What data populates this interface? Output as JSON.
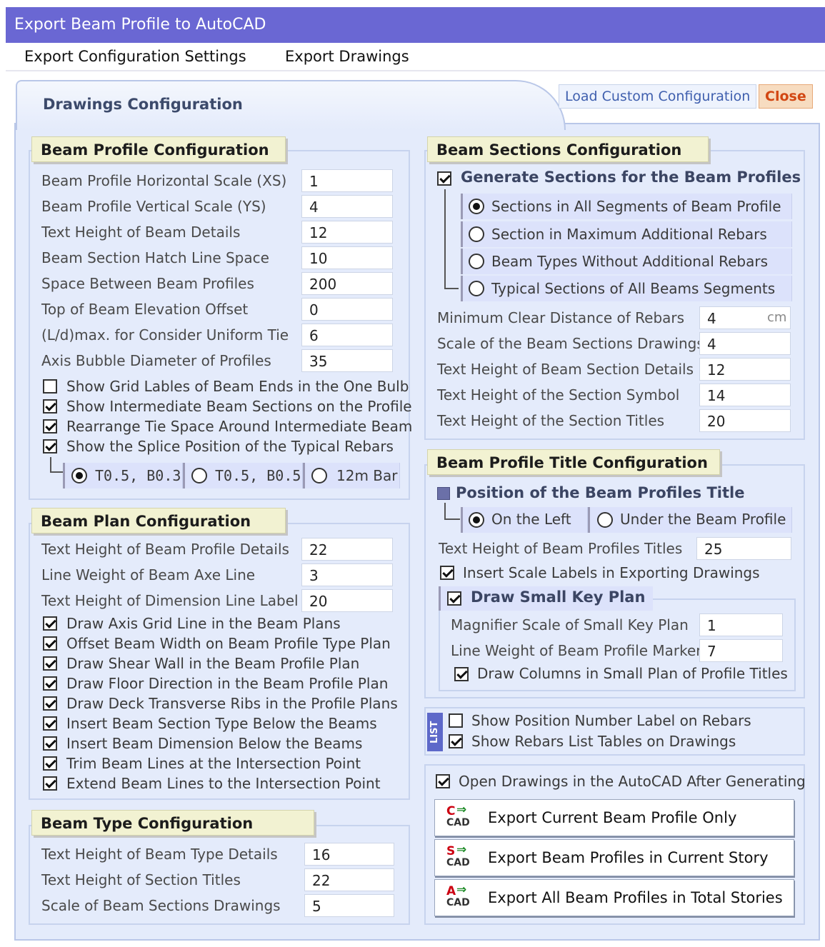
{
  "window": {
    "title": "Export Beam Profile to AutoCAD"
  },
  "menu": [
    "Export Configuration Settings",
    "Export Drawings"
  ],
  "tab": {
    "label": "Drawings Configuration"
  },
  "toolbar": {
    "load_label": "Load Custom Configuration",
    "close_label": "Close"
  },
  "beam_profile": {
    "title": "Beam Profile Configuration",
    "fields": [
      {
        "label": "Beam Profile Horizontal Scale  (XS)",
        "value": "1"
      },
      {
        "label": "Beam Profile Vertical  Scale      (YS)",
        "value": "4"
      },
      {
        "label": "Text Height of Beam Details",
        "value": "12"
      },
      {
        "label": "Beam Section Hatch Line Space",
        "value": "10"
      },
      {
        "label": "Space Between Beam Profiles",
        "value": "200"
      },
      {
        "label": "Top of  Beam Elevation Offset",
        "value": "0"
      },
      {
        "label": "(L/d)max. for Consider Uniform Tie",
        "value": "6"
      },
      {
        "label": "Axis Bubble Diameter of  Profiles",
        "value": "35"
      }
    ],
    "checks": [
      {
        "label": "Show Grid Lables of Beam Ends in the One Bulb",
        "checked": false
      },
      {
        "label": "Show Intermediate Beam Sections on the Profile",
        "checked": true
      },
      {
        "label": "Rearrange Tie Space Around Intermediate Beam",
        "checked": true
      },
      {
        "label": "Show the Splice Position of the Typical Rebars",
        "checked": true
      }
    ],
    "splice_options": [
      {
        "label": "T0.5, B0.3",
        "selected": true
      },
      {
        "label": "T0.5, B0.5",
        "selected": false
      },
      {
        "label": "12m Bar",
        "selected": false
      }
    ]
  },
  "beam_plan": {
    "title": "Beam Plan Configuration",
    "fields": [
      {
        "label": "Text Height of Beam Profile Details",
        "value": "22"
      },
      {
        "label": "Line Weight of Beam Axe Line",
        "value": "3"
      },
      {
        "label": "Text Height of Dimension Line Label",
        "value": "20"
      }
    ],
    "checks": [
      {
        "label": "Draw Axis Grid Line in the Beam Plans",
        "checked": true
      },
      {
        "label": "Offset Beam Width on Beam Profile Type Plan",
        "checked": true
      },
      {
        "label": "Draw Shear Wall in the Beam Profile Plan",
        "checked": true
      },
      {
        "label": "Draw Floor Direction in the Beam Profile Plan",
        "checked": true
      },
      {
        "label": "Draw Deck Transverse Ribs in the Profile Plans",
        "checked": true
      },
      {
        "label": "Insert Beam Section Type Below the Beams",
        "checked": true
      },
      {
        "label": "Insert Beam Dimension Below the Beams",
        "checked": true
      },
      {
        "label": "Trim Beam Lines at the Intersection Point",
        "checked": true
      },
      {
        "label": "Extend Beam Lines to the Intersection Point",
        "checked": true
      }
    ]
  },
  "beam_type": {
    "title": "Beam Type Configuration",
    "fields": [
      {
        "label": "Text Height of Beam Type Details",
        "value": "16"
      },
      {
        "label": "Text  Height of Section Titles",
        "value": "22"
      },
      {
        "label": "Scale of Beam Sections Drawings",
        "value": "5"
      }
    ]
  },
  "beam_sections": {
    "title": "Beam Sections Configuration",
    "generate": {
      "label": "Generate Sections for the Beam Profiles",
      "checked": true
    },
    "options": [
      {
        "label": "Sections in All Segments of Beam Profile",
        "selected": true
      },
      {
        "label": "Section in Maximum Additional Rebars",
        "selected": false
      },
      {
        "label": "Beam Types Without Additional Rebars",
        "selected": false
      },
      {
        "label": "Typical Sections of All Beams Segments",
        "selected": false
      }
    ],
    "fields": [
      {
        "label": "Minimum Clear Distance of Rebars",
        "value": "4",
        "unit": "cm"
      },
      {
        "label": "Scale of the Beam Sections Drawings",
        "value": "4"
      },
      {
        "label": "Text Height of Beam Section Details",
        "value": "12"
      },
      {
        "label": "Text Height of the Section Symbol",
        "value": "14"
      },
      {
        "label": "Text Height of the Section Titles",
        "value": "20"
      }
    ]
  },
  "profile_title": {
    "title": "Beam Profile Title Configuration",
    "position_label": "Position of the Beam Profiles Title",
    "position_options": [
      {
        "label": "On the Left",
        "selected": true
      },
      {
        "label": "Under the Beam Profile",
        "selected": false
      }
    ],
    "text_height": {
      "label": "Text Height of Beam Profiles Titles",
      "value": "25"
    },
    "insert_scale": {
      "label": "Insert Scale Labels in Exporting Drawings",
      "checked": true
    },
    "key_plan": {
      "label": "Draw Small Key Plan",
      "checked": true,
      "fields": [
        {
          "label": "Magnifier Scale of Small Key Plan",
          "value": "1"
        },
        {
          "label": "Line Weight of Beam Profile Marker",
          "value": "7"
        }
      ],
      "columns": {
        "label": "Draw Columns in Small Plan of Profile Titles",
        "checked": true
      }
    }
  },
  "list_options": {
    "badge": "LIST",
    "checks": [
      {
        "label": "Show Position Number Label on Rebars",
        "checked": false
      },
      {
        "label": "Show Rebars  List Tables  on  Drawings",
        "checked": true
      }
    ]
  },
  "export": {
    "open_after": {
      "label": "Open Drawings in the AutoCAD After Generating",
      "checked": true
    },
    "buttons": [
      {
        "icon_letter": "C",
        "icon_text": "CAD",
        "label": "Export Current Beam Profile Only"
      },
      {
        "icon_letter": "S",
        "icon_text": "CAD",
        "label": "Export Beam Profiles in Current Story"
      },
      {
        "icon_letter": "A",
        "icon_text": "CAD",
        "label": "Export All Beam Profiles in Total Stories"
      }
    ]
  }
}
